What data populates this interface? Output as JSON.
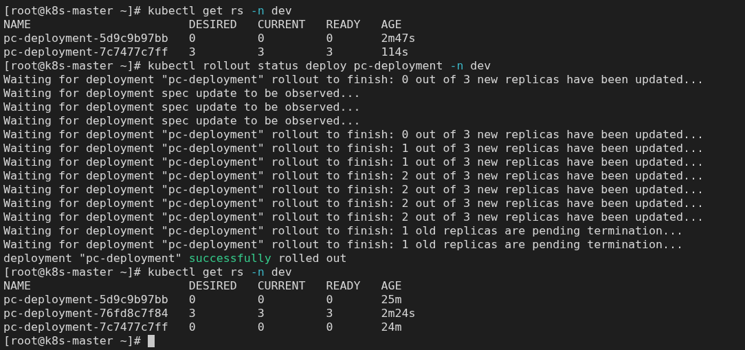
{
  "terminal": {
    "lines": [
      {
        "kind": "prompt",
        "prompt": "[root@k8s-master ~]#",
        "segments": [
          {
            "text": "kubectl get rs ",
            "kind": "normal"
          },
          {
            "text": "-n",
            "kind": "flag"
          },
          {
            "text": " dev",
            "kind": "normal"
          }
        ]
      },
      {
        "kind": "table",
        "columns": [
          "NAME",
          "DESIRED",
          "CURRENT",
          "READY",
          "AGE"
        ],
        "rows": [
          [
            "pc-deployment-5d9c9b97bb",
            "0",
            "0",
            "0",
            "2m47s"
          ],
          [
            "pc-deployment-7c7477c7ff",
            "3",
            "3",
            "3",
            "114s"
          ]
        ]
      },
      {
        "kind": "prompt",
        "prompt": "[root@k8s-master ~]#",
        "segments": [
          {
            "text": "kubectl rollout status deploy pc-deployment ",
            "kind": "normal"
          },
          {
            "text": "-n",
            "kind": "flag"
          },
          {
            "text": " dev",
            "kind": "normal"
          }
        ]
      },
      {
        "kind": "output",
        "segments": [
          {
            "text": "Waiting for deployment \"pc-deployment\" rollout to finish: 0 out of 3 new replicas have been updated...",
            "kind": "normal"
          }
        ]
      },
      {
        "kind": "output",
        "segments": [
          {
            "text": "Waiting for deployment spec update to be observed...",
            "kind": "normal"
          }
        ]
      },
      {
        "kind": "output",
        "segments": [
          {
            "text": "Waiting for deployment spec update to be observed...",
            "kind": "normal"
          }
        ]
      },
      {
        "kind": "output",
        "segments": [
          {
            "text": "Waiting for deployment spec update to be observed...",
            "kind": "normal"
          }
        ]
      },
      {
        "kind": "output",
        "segments": [
          {
            "text": "Waiting for deployment \"pc-deployment\" rollout to finish: 0 out of 3 new replicas have been updated...",
            "kind": "normal"
          }
        ]
      },
      {
        "kind": "output",
        "segments": [
          {
            "text": "Waiting for deployment \"pc-deployment\" rollout to finish: 1 out of 3 new replicas have been updated...",
            "kind": "normal"
          }
        ]
      },
      {
        "kind": "output",
        "segments": [
          {
            "text": "Waiting for deployment \"pc-deployment\" rollout to finish: 1 out of 3 new replicas have been updated...",
            "kind": "normal"
          }
        ]
      },
      {
        "kind": "output",
        "segments": [
          {
            "text": "Waiting for deployment \"pc-deployment\" rollout to finish: 2 out of 3 new replicas have been updated...",
            "kind": "normal"
          }
        ]
      },
      {
        "kind": "output",
        "segments": [
          {
            "text": "Waiting for deployment \"pc-deployment\" rollout to finish: 2 out of 3 new replicas have been updated...",
            "kind": "normal"
          }
        ]
      },
      {
        "kind": "output",
        "segments": [
          {
            "text": "Waiting for deployment \"pc-deployment\" rollout to finish: 2 out of 3 new replicas have been updated...",
            "kind": "normal"
          }
        ]
      },
      {
        "kind": "output",
        "segments": [
          {
            "text": "Waiting for deployment \"pc-deployment\" rollout to finish: 2 out of 3 new replicas have been updated...",
            "kind": "normal"
          }
        ]
      },
      {
        "kind": "output",
        "segments": [
          {
            "text": "Waiting for deployment \"pc-deployment\" rollout to finish: 1 old replicas are pending termination...",
            "kind": "normal"
          }
        ]
      },
      {
        "kind": "output",
        "segments": [
          {
            "text": "Waiting for deployment \"pc-deployment\" rollout to finish: 1 old replicas are pending termination...",
            "kind": "normal"
          }
        ]
      },
      {
        "kind": "output",
        "segments": [
          {
            "text": "deployment \"pc-deployment\" ",
            "kind": "normal"
          },
          {
            "text": "successfully",
            "kind": "success"
          },
          {
            "text": " rolled out",
            "kind": "normal"
          }
        ]
      },
      {
        "kind": "prompt",
        "prompt": "[root@k8s-master ~]#",
        "segments": [
          {
            "text": "kubectl get rs ",
            "kind": "normal"
          },
          {
            "text": "-n",
            "kind": "flag"
          },
          {
            "text": " dev",
            "kind": "normal"
          }
        ]
      },
      {
        "kind": "table",
        "columns": [
          "NAME",
          "DESIRED",
          "CURRENT",
          "READY",
          "AGE"
        ],
        "rows": [
          [
            "pc-deployment-5d9c9b97bb",
            "0",
            "0",
            "0",
            "25m"
          ],
          [
            "pc-deployment-76fd8c7f84",
            "3",
            "3",
            "3",
            "2m24s"
          ],
          [
            "pc-deployment-7c7477c7ff",
            "0",
            "0",
            "0",
            "24m"
          ]
        ]
      },
      {
        "kind": "prompt",
        "prompt": "[root@k8s-master ~]#",
        "cursor": true
      }
    ]
  }
}
